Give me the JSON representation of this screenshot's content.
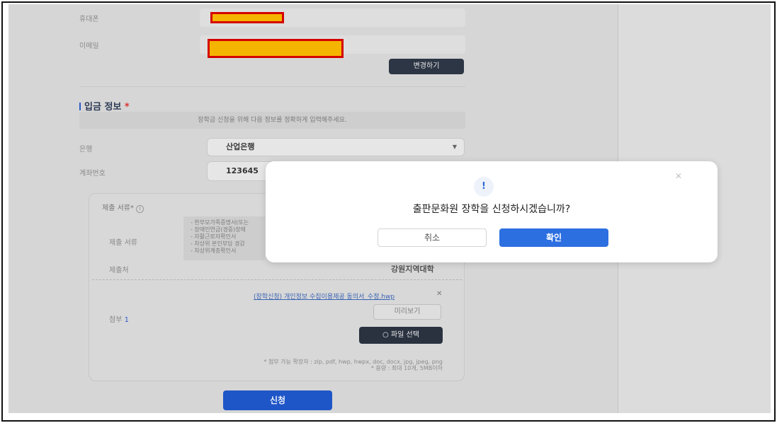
{
  "contact": {
    "phone_label": "휴대폰",
    "email_label": "이메일",
    "change_button": "변경하기"
  },
  "deposit": {
    "title": "입금 정보",
    "required_mark": "*",
    "notice": "장학금 신청을 위해 다음 정보를 정확하게 입력해주세요.",
    "bank_label": "은행",
    "bank_value": "산업은행",
    "account_label": "계좌번호",
    "account_value": "123645"
  },
  "documents": {
    "header": "제출 서류*",
    "info_icon": "info-icon",
    "row_label": "제출 서류",
    "items": [
      "- 한부모가족증명서(또는",
      "- 장애인연금(경증)장애",
      "- 자활근로자확인서",
      "- 차상위 본인부담 경감",
      "- 차상위계층확인서"
    ],
    "submit_to_label": "제출처",
    "submit_to_value": "강원지역대학",
    "attach_label": "첨부",
    "attach_count": "1",
    "file_name": "(장학신청) 개인정보 수집이용제공 동의서_수정.hwp",
    "remove_icon": "close-icon",
    "preview_button": "미리보기",
    "select_file_button": "파일 선택",
    "search_icon": "search-icon",
    "note_formats": "* 첨부 가능 확장자 : zip, pdf, hwp, hwpx, doc, docx, jpg, jpeg, png",
    "note_limit": "* 용량 : 최대 10개, 5MB이하"
  },
  "submit_button": "신청",
  "dialog": {
    "alert_icon": "!",
    "close_icon": "close-icon",
    "message": "출판문화원 장학을 신청하시겠습니까?",
    "cancel": "취소",
    "confirm": "확인"
  },
  "colors": {
    "primary": "#2c6fe0",
    "dark_button": "#2d3644",
    "redaction_fill": "#f5b400",
    "redaction_border": "#d40000"
  }
}
